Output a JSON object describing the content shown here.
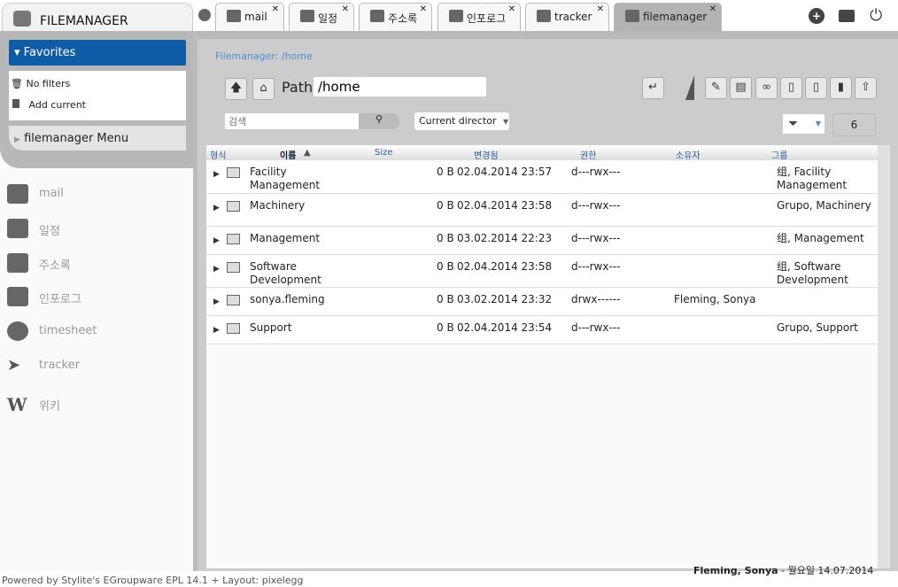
{
  "app": {
    "title": "FILEMANAGER"
  },
  "tabs": [
    {
      "label": "mail"
    },
    {
      "label": "일정"
    },
    {
      "label": "주소록"
    },
    {
      "label": "인포로그"
    },
    {
      "label": "tracker"
    },
    {
      "label": "filemanager",
      "active": true
    }
  ],
  "header_icons": [
    "plus-circle-icon",
    "print-icon",
    "power-icon"
  ],
  "favorites": {
    "title": "Favorites",
    "items": [
      "No filters",
      "Add current"
    ]
  },
  "menu": {
    "title": "filemanager Menu"
  },
  "sidebar": {
    "items": [
      {
        "label": "mail",
        "icon": "mail-icon"
      },
      {
        "label": "일정",
        "icon": "calendar-icon"
      },
      {
        "label": "주소록",
        "icon": "addressbook-icon"
      },
      {
        "label": "인포로그",
        "icon": "clipboard-icon"
      },
      {
        "label": "timesheet",
        "icon": "clock-icon"
      },
      {
        "label": "tracker",
        "icon": "tracker-icon"
      },
      {
        "label": "위키",
        "icon": "wiki-icon"
      }
    ]
  },
  "main": {
    "breadcrumb": "Filemanager: /home",
    "path_label": "Path",
    "path_value": "/home",
    "search_placeholder": "검색",
    "select_value": "Current director",
    "count": "6"
  },
  "table": {
    "headers": [
      "형식",
      "이름",
      "Size",
      "변경됨",
      "권한",
      "소유자",
      "그룹"
    ],
    "rows": [
      {
        "name": "Facility Management",
        "size": "0 B",
        "modified": "02.04.2014 23:57",
        "perms": "d---rwx---",
        "owner": "",
        "group": "组, Facility Management"
      },
      {
        "name": "Machinery",
        "size": "0 B",
        "modified": "02.04.2014 23:58",
        "perms": "d---rwx---",
        "owner": "",
        "group": "Grupo, Machinery"
      },
      {
        "name": "Management",
        "size": "0 B",
        "modified": "03.02.2014 22:23",
        "perms": "d---rwx---",
        "owner": "",
        "group": "组, Management"
      },
      {
        "name": "Software Development",
        "size": "0 B",
        "modified": "02.04.2014 23:58",
        "perms": "d---rwx---",
        "owner": "",
        "group": "组, Software Development"
      },
      {
        "name": "sonya.fleming",
        "size": "0 B",
        "modified": "03.02.2014 23:32",
        "perms": "drwx------",
        "owner": "Fleming, Sonya",
        "group": ""
      },
      {
        "name": "Support",
        "size": "0 B",
        "modified": "02.04.2014 23:54",
        "perms": "d---rwx---",
        "owner": "",
        "group": "Grupo, Support"
      }
    ]
  },
  "status": {
    "user": "Fleming, Sonya",
    "date": "월요일 14.07.2014"
  },
  "footer": "Powered by Stylite's EGroupware EPL 14.1 + Layout: pixelegg",
  "colors": {
    "accent": "#0f5ca6",
    "link": "#4a8fd1"
  }
}
